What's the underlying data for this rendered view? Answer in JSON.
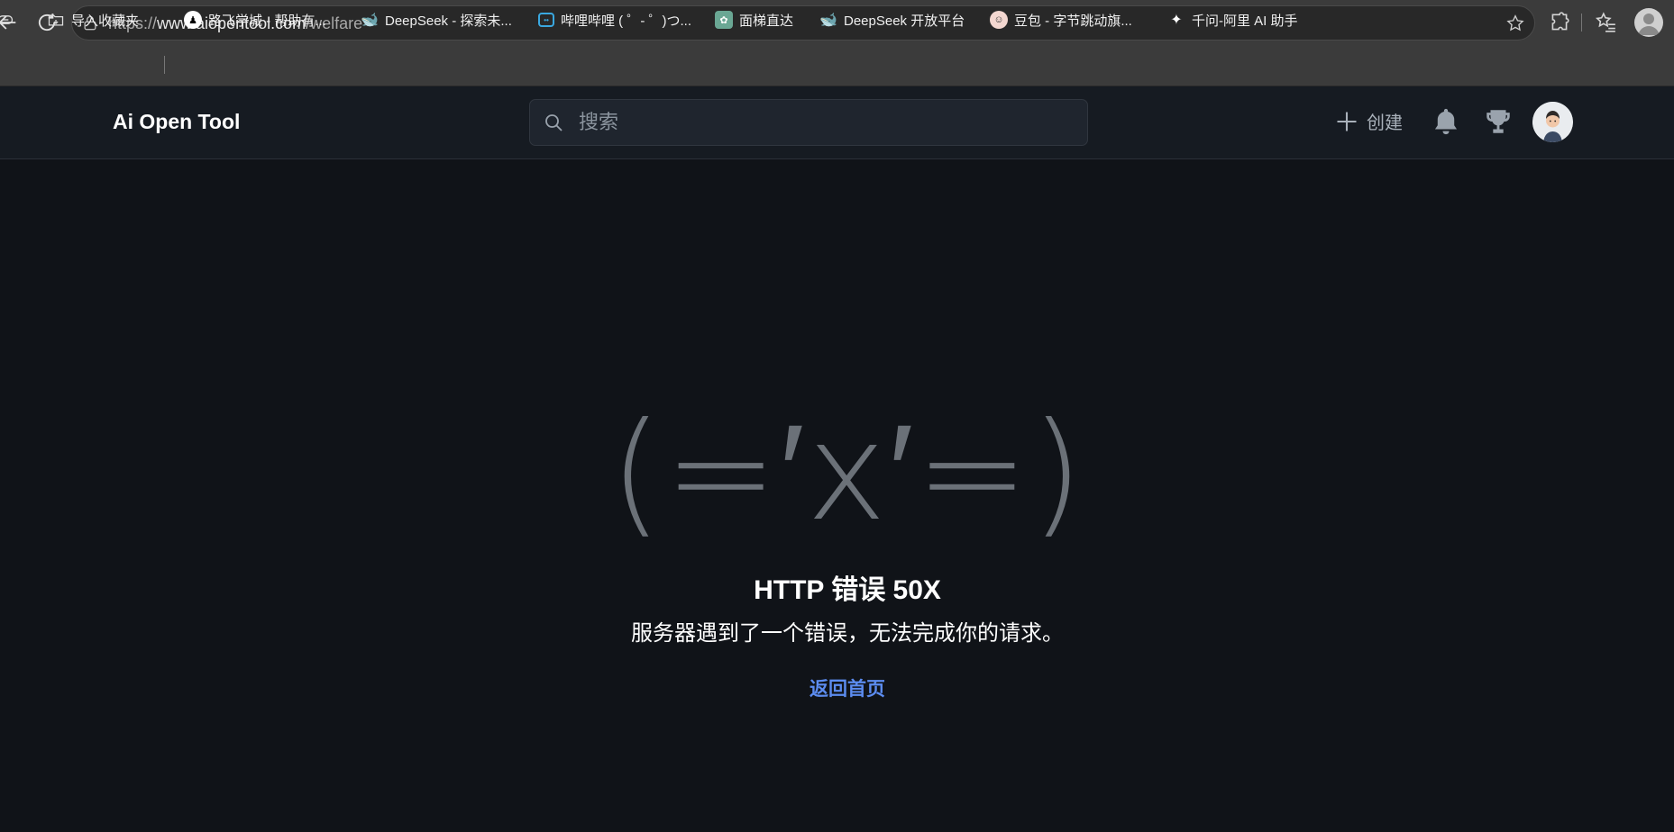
{
  "browser": {
    "url_prefix": "https://",
    "url_domain": "www.aiopentool.com",
    "url_path": "/welfare"
  },
  "bookmarks": [
    {
      "label": "导入收藏夹",
      "icon": "folder-import-icon"
    },
    {
      "label": "路飞学城 - 帮助有...",
      "icon": "luffy-icon"
    },
    {
      "label": "DeepSeek - 探索未...",
      "icon": "deepseek-icon"
    },
    {
      "label": "哔哩哔哩 ( ゜- ゜)つ...",
      "icon": "bilibili-icon"
    },
    {
      "label": "面梯直达",
      "icon": "openai-icon"
    },
    {
      "label": "DeepSeek 开放平台",
      "icon": "deepseek-platform-icon"
    },
    {
      "label": "豆包 - 字节跳动旗...",
      "icon": "doubao-icon"
    },
    {
      "label": "千问-阿里 AI 助手",
      "icon": "qwen-icon"
    }
  ],
  "header": {
    "logo": "Ai Open Tool",
    "search_placeholder": "搜索",
    "create_label": "创建"
  },
  "error": {
    "kaomoji": "(=′x′=)",
    "title": "HTTP 错误 50X",
    "description": "服务器遇到了一个错误，无法完成你的请求。",
    "home_link": "返回首页"
  },
  "colors": {
    "page_bg": "#101318",
    "header_bg": "#161b22",
    "link": "#5c8cf0",
    "kaomoji": "#6b7178"
  }
}
